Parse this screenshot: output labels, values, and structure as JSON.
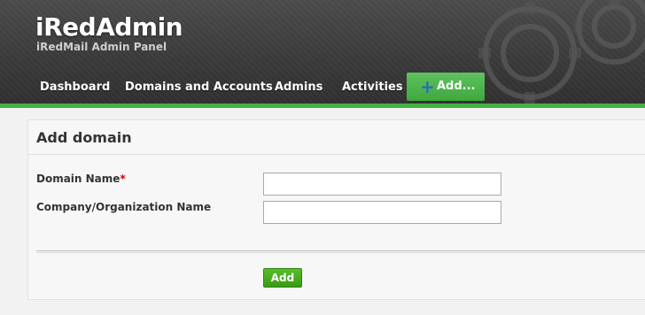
{
  "brand": {
    "title": "iRedAdmin",
    "subtitle": "iRedMail Admin Panel"
  },
  "nav": {
    "items": [
      {
        "label": "Dashboard"
      },
      {
        "label": "Domains and Accounts"
      },
      {
        "label": "Admins"
      },
      {
        "label": "Activities"
      }
    ],
    "add_label": "Add..."
  },
  "form": {
    "title": "Add domain",
    "fields": [
      {
        "label": "Domain Name",
        "required_mark": "*",
        "value": "",
        "placeholder": ""
      },
      {
        "label": "Company/Organization Name",
        "value": "",
        "placeholder": ""
      }
    ],
    "submit_label": "Add"
  },
  "colors": {
    "accent_green": "#43b243",
    "header_dark": "#3a3a3a",
    "required_red": "#d40000"
  }
}
